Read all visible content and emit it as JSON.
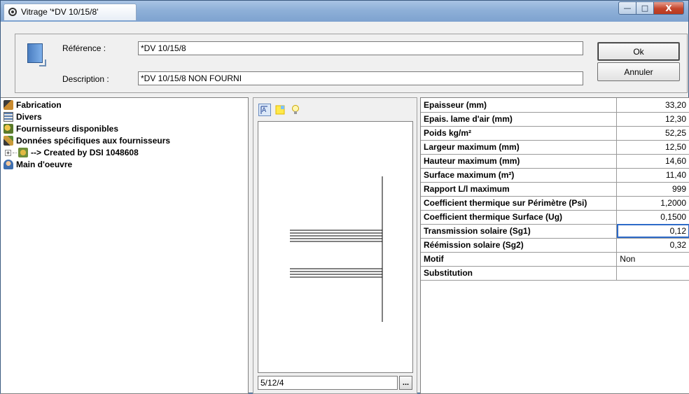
{
  "window": {
    "title": "Vitrage '*DV 10/15/8'",
    "minimize_glyph": "—",
    "maximize_glyph": "□",
    "close_glyph": "X"
  },
  "header": {
    "reference_label": "Référence :",
    "reference_value": "*DV 10/15/8",
    "description_label": "Description :",
    "description_value": "*DV 10/15/8  NON FOURNI",
    "ok_label": "Ok",
    "cancel_label": "Annuler"
  },
  "tree": {
    "items": [
      {
        "label": "Fabrication",
        "icon": "fabrication-icon"
      },
      {
        "label": "Divers",
        "icon": "divers-icon"
      },
      {
        "label": "Fournisseurs disponibles",
        "icon": "suppliers-icon"
      },
      {
        "label": "Données spécifiques aux fournisseurs",
        "icon": "supplier-data-icon"
      },
      {
        "label": "--> Created by DSI 1048608",
        "icon": "created-by-icon",
        "expander": "+"
      },
      {
        "label": "Main d'oeuvre",
        "icon": "labor-icon"
      }
    ]
  },
  "preview": {
    "toolbar": [
      "text-label-tool-icon",
      "color-tool-icon",
      "light-bulb-icon"
    ],
    "composition_value": "5/12/4",
    "ellipsis_label": "..."
  },
  "properties": [
    {
      "label": "Epaisseur (mm)",
      "value": "33,20"
    },
    {
      "label": "Epais. lame d'air (mm)",
      "value": "12,30"
    },
    {
      "label": "Poids kg/m²",
      "value": "52,25"
    },
    {
      "label": "Largeur maximum (mm)",
      "value": "12,50"
    },
    {
      "label": "Hauteur maximum (mm)",
      "value": "14,60"
    },
    {
      "label": "Surface maximum (m²)",
      "value": "11,40"
    },
    {
      "label": "Rapport L/l maximum",
      "value": "999"
    },
    {
      "label": "Coefficient thermique sur Périmètre (Psi)",
      "value": "1,2000"
    },
    {
      "label": "Coefficient thermique Surface (Ug)",
      "value": "0,1500"
    },
    {
      "label": "Transmission solaire (Sg1)",
      "value": "0,12"
    },
    {
      "label": "Réémission solaire (Sg2)",
      "value": "0,32"
    },
    {
      "label": "Motif",
      "value": "Non"
    },
    {
      "label": "Substitution",
      "value": ""
    }
  ],
  "colors": {
    "selection_outline": "#2d6ac8",
    "titlebar": "#8eb0d8",
    "close_button": "#c4452c"
  }
}
